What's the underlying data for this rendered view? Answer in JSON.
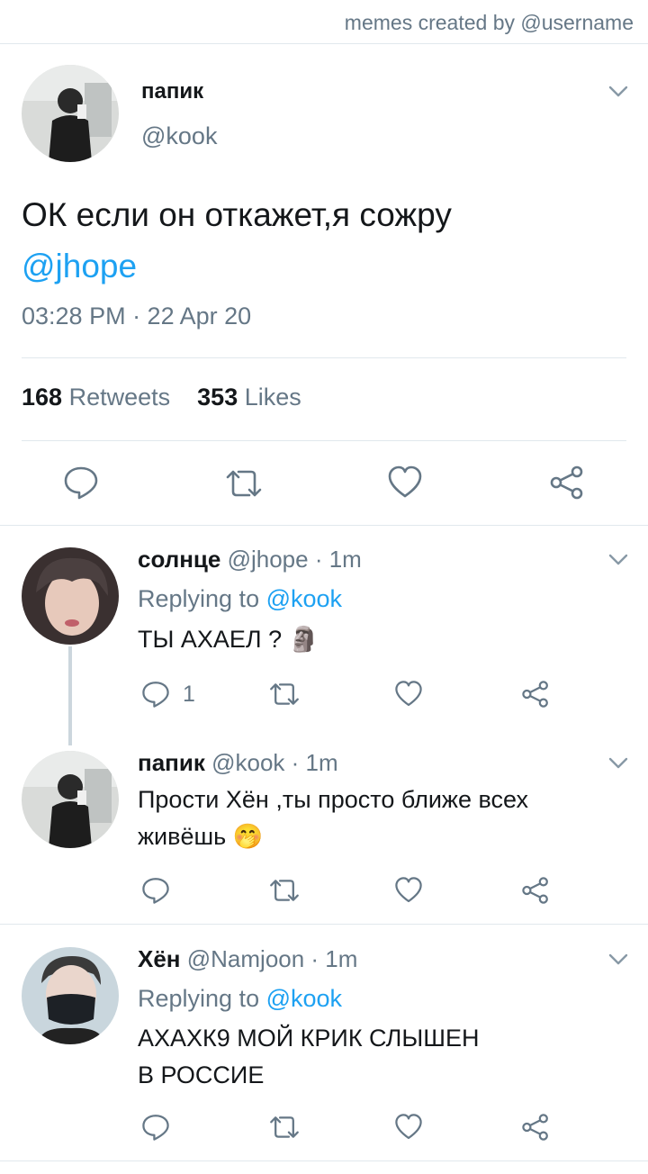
{
  "credit": "memes created by @username",
  "main_tweet": {
    "name": "папик",
    "handle": "@kook",
    "text": "ОК если он откажет,я сожру",
    "mention": "@jhope",
    "timestamp": "03:28 PM · 22 Apr 20",
    "retweets_count": "168",
    "retweets_label": "Retweets",
    "likes_count": "353",
    "likes_label": "Likes"
  },
  "replies": [
    {
      "name": "солнце",
      "meta": "@jhope · 1m",
      "replying_label": "Replying to",
      "replying_to": "@kook",
      "text": "ТЫ АХАЕЛ ?",
      "emoji": "🗿",
      "reply_count": "1"
    },
    {
      "name": "папик",
      "meta": "@kook · 1m",
      "text_line1": "Прости Хён ,ты просто ближе всех",
      "text_line2": "живёшь",
      "emoji": "🤭"
    },
    {
      "name": "Хён",
      "meta": "@Namjoon · 1m",
      "replying_label": "Replying to",
      "replying_to": "@kook",
      "text_line1": "АХАХК9 МОЙ КРИК СЛЫШЕН",
      "text_line2": "В РОССИЕ"
    }
  ],
  "icons": {
    "reply": "reply-icon",
    "retweet": "retweet-icon",
    "like": "heart-icon",
    "share": "share-icon",
    "menu": "chevron-down-icon"
  },
  "colors": {
    "accent": "#1da1f2",
    "secondary_text": "#657786",
    "icon": "#657786",
    "divider": "#e1e8ed"
  }
}
